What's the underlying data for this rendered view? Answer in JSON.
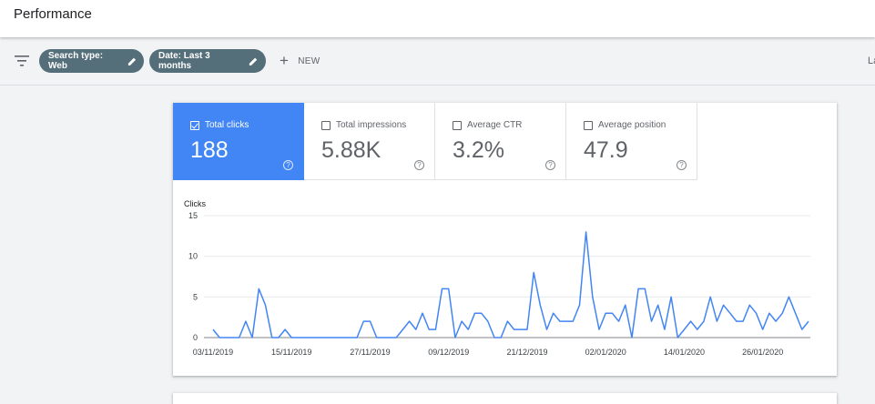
{
  "header": {
    "title": "Performance"
  },
  "filters": {
    "chips": [
      {
        "label": "Search type: Web"
      },
      {
        "label": "Date: Last 3 months"
      }
    ],
    "new_label": "NEW",
    "cutoff_text": "La"
  },
  "metrics": [
    {
      "label": "Total clicks",
      "value": "188",
      "active": true
    },
    {
      "label": "Total impressions",
      "value": "5.88K",
      "active": false
    },
    {
      "label": "Average CTR",
      "value": "3.2%",
      "active": false
    },
    {
      "label": "Average position",
      "value": "47.9",
      "active": false
    }
  ],
  "colors": {
    "accent": "#4285f4",
    "chip": "#546e7a",
    "line": "#4285f4"
  },
  "chart_data": {
    "type": "line",
    "ylabel": "Clicks",
    "ylim": [
      0,
      15
    ],
    "yticks": [
      0,
      5,
      10,
      15
    ],
    "grid": true,
    "x_ticks": [
      "03/11/2019",
      "15/11/2019",
      "27/11/2019",
      "09/12/2019",
      "21/12/2019",
      "02/01/2020",
      "14/01/2020",
      "26/01/2020"
    ],
    "series": [
      {
        "values": [
          1,
          0,
          0,
          0,
          0,
          2,
          0,
          6,
          4,
          0,
          0,
          1,
          0,
          0,
          0,
          0,
          0,
          0,
          0,
          0,
          0,
          0,
          0,
          2,
          2,
          0,
          0,
          0,
          0,
          1,
          2,
          1,
          3,
          1,
          1,
          6,
          6,
          0,
          2,
          1,
          3,
          3,
          2,
          0,
          0,
          2,
          1,
          1,
          1,
          8,
          4,
          1,
          3,
          2,
          2,
          2,
          4,
          13,
          5,
          1,
          3,
          3,
          2,
          4,
          0,
          6,
          6,
          2,
          4,
          1,
          5,
          0,
          1,
          2,
          1,
          2,
          5,
          2,
          4,
          3,
          2,
          2,
          4,
          3,
          1,
          3,
          2,
          3,
          5,
          3,
          1,
          2
        ]
      }
    ]
  }
}
